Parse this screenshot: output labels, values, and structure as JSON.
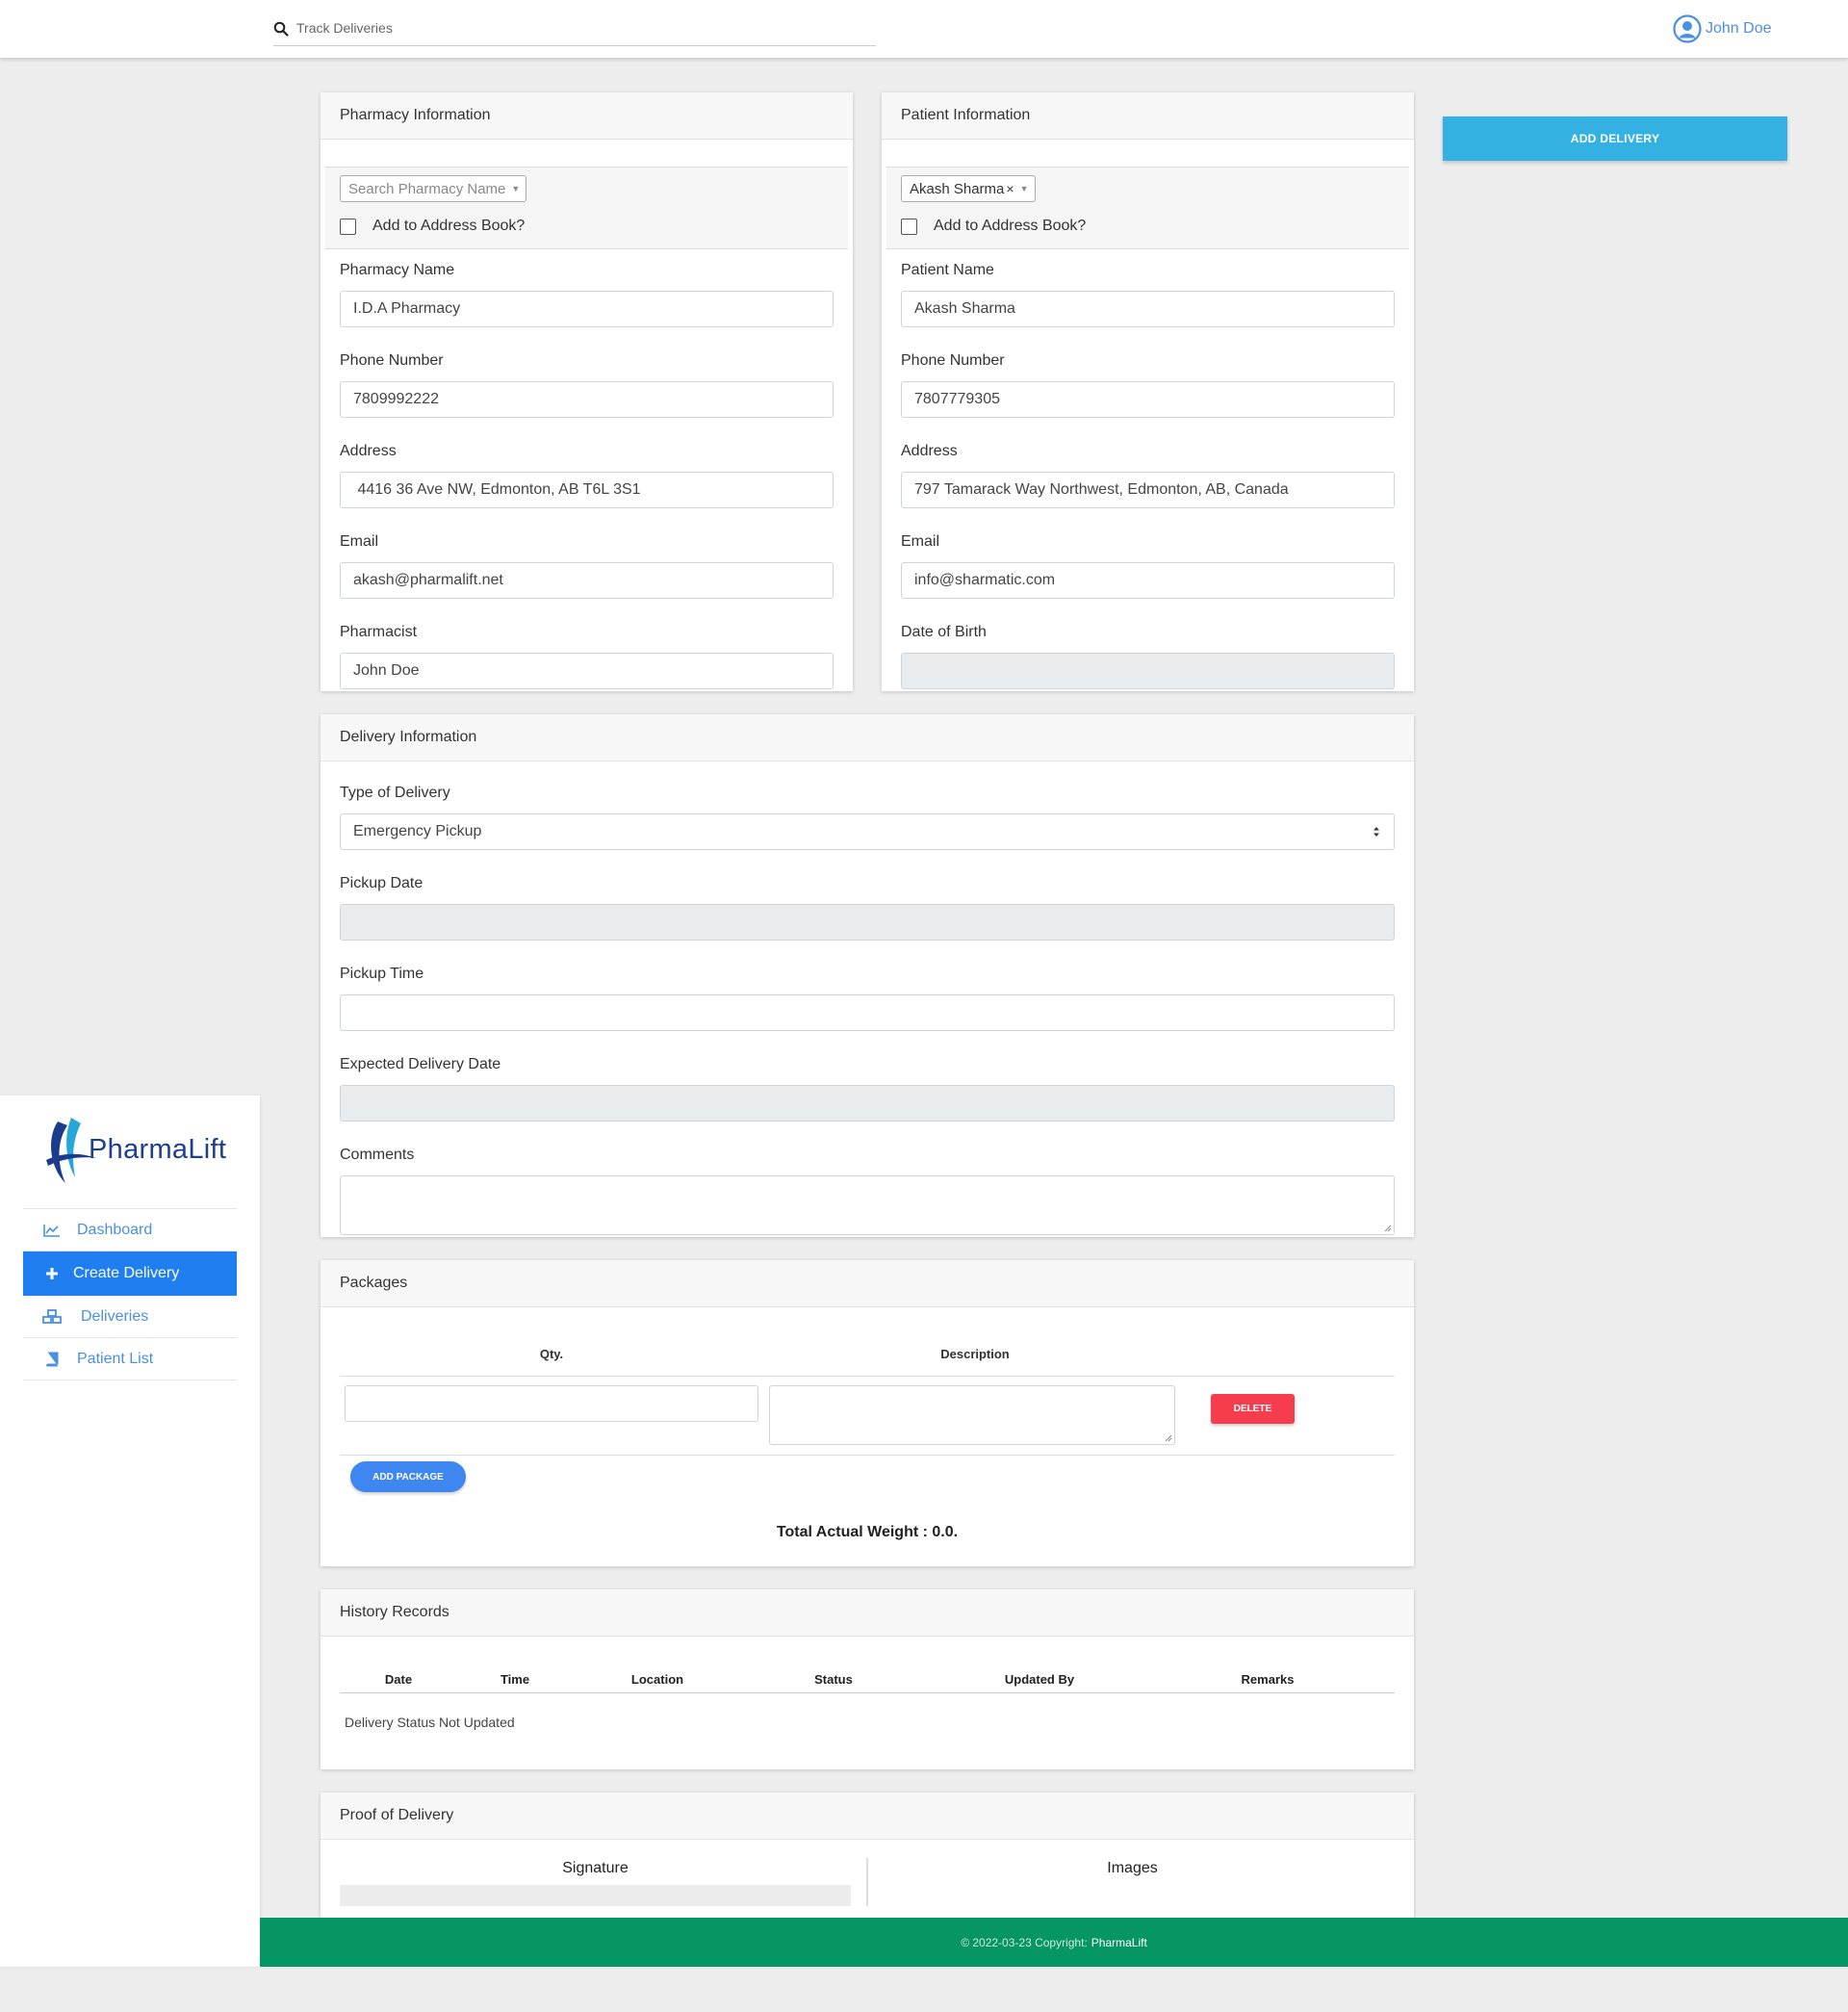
{
  "topbar": {
    "search_placeholder": "Track Deliveries",
    "user_name": "John Doe"
  },
  "sidebar": {
    "logo_text": "PharmaLift",
    "items": [
      {
        "label": "Dashboard",
        "icon": "chart-line-icon"
      },
      {
        "label": "Create Delivery",
        "icon": "plus-icon"
      },
      {
        "label": "Deliveries",
        "icon": "boxes-icon"
      },
      {
        "label": "Patient List",
        "icon": "book-icon"
      }
    ]
  },
  "pharmacy": {
    "title": "Pharmacy Information",
    "search_placeholder": "Search Pharmacy Name",
    "address_book_label": "Add to Address Book?",
    "fields": [
      {
        "label": "Pharmacy Name",
        "value": "I.D.A Pharmacy"
      },
      {
        "label": "Phone Number",
        "value": "7809992222"
      },
      {
        "label": "Address",
        "value": " 4416 36 Ave NW, Edmonton, AB T6L 3S1"
      },
      {
        "label": "Email",
        "value": "akash@pharmalift.net"
      },
      {
        "label": "Pharmacist",
        "value": "John Doe"
      }
    ]
  },
  "patient": {
    "title": "Patient Information",
    "selected": "Akash Sharma",
    "address_book_label": "Add to Address Book?",
    "fields": [
      {
        "label": "Patient Name",
        "value": "Akash Sharma"
      },
      {
        "label": "Phone Number",
        "value": "7807779305"
      },
      {
        "label": "Address",
        "value": "797 Tamarack Way Northwest, Edmonton, AB, Canada"
      },
      {
        "label": "Email",
        "value": "info@sharmatic.com"
      },
      {
        "label": "Date of Birth",
        "value": ""
      }
    ]
  },
  "actions": {
    "add_delivery": "ADD DELIVERY"
  },
  "delivery": {
    "title": "Delivery Information",
    "type_label": "Type of Delivery",
    "type_value": "Emergency Pickup",
    "pickup_date_label": "Pickup Date",
    "pickup_time_label": "Pickup Time",
    "expected_label": "Expected Delivery Date",
    "comments_label": "Comments"
  },
  "packages": {
    "title": "Packages",
    "col_qty": "Qty.",
    "col_desc": "Description",
    "delete": "DELETE",
    "add_package": "ADD PACKAGE",
    "total_weight": "Total Actual Weight : 0.0."
  },
  "history": {
    "title": "History Records",
    "columns": [
      "Date",
      "Time",
      "Location",
      "Status",
      "Updated By",
      "Remarks"
    ],
    "empty": "Delivery Status Not Updated"
  },
  "proof": {
    "title": "Proof of Delivery",
    "signature": "Signature",
    "images": "Images"
  },
  "footer": {
    "copyright": "© 2022-03-23 Copyright:",
    "brand": "PharmaLift"
  },
  "colors": {
    "accent_blue": "#1f7ff0",
    "add_delivery": "#34b1e3",
    "delete_red": "#f53d4e",
    "footer_green": "#059663"
  }
}
